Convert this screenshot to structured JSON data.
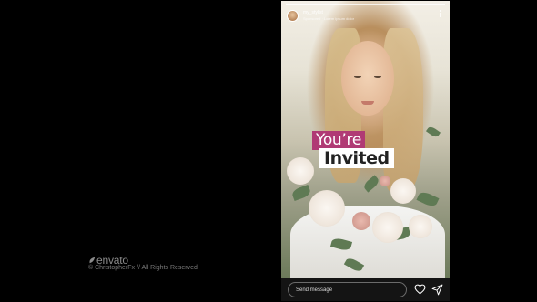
{
  "story": {
    "username": "my_stylist",
    "subline": "Sponsored · Lorem ipsum dolor",
    "headline_line1": "You’re",
    "headline_line2": "Invited",
    "headline_colors": {
      "line1_bg": "#b03a74",
      "line2_bg": "#ffffff"
    },
    "icons": {
      "avatar": "avatar",
      "more": "more-vertical-icon",
      "like": "heart-icon",
      "share": "send-icon"
    }
  },
  "composer": {
    "placeholder": "Send message"
  },
  "watermark": {
    "brand": "envato",
    "copyright": "© ChristopherFx // All Rights Reserved"
  }
}
